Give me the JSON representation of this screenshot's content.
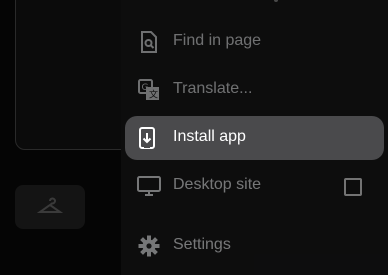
{
  "menu": {
    "items": [
      {
        "label": "Find in page",
        "icon": "find-in-page-icon"
      },
      {
        "label": "Translate...",
        "icon": "translate-icon"
      },
      {
        "label": "Install app",
        "icon": "install-app-icon",
        "highlighted": true
      },
      {
        "label": "Desktop site",
        "icon": "desktop-icon",
        "checked": false
      },
      {
        "label": "Settings",
        "icon": "gear-icon"
      }
    ]
  },
  "colors": {
    "menu_background": "#1c1c1d",
    "highlight": "#4a4a4c",
    "text": "#e8eaed"
  }
}
